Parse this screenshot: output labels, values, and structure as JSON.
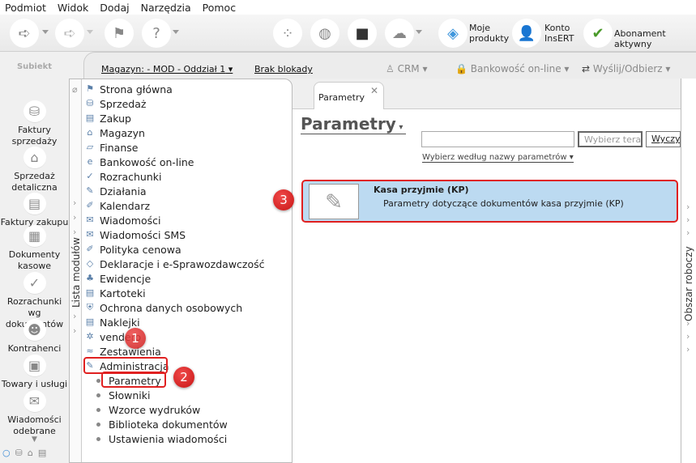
{
  "menu": [
    "Podmiot",
    "Widok",
    "Dodaj",
    "Narzędzia",
    "Pomoc"
  ],
  "toolbar": {
    "moje_produkty": "Moje\nprodukty",
    "moje1": "Moje",
    "moje2": "produkty",
    "konto1": "Konto",
    "konto2": "InsERT",
    "insert_logo": "InsERT",
    "abonament": "Abonament aktywny"
  },
  "logo": {
    "text": "Subiekt"
  },
  "topbar": {
    "magazyn": "Magazyn: - MOD - Oddział 1",
    "blokada": "Brak blokady",
    "crm": "CRM",
    "bank": "Bankowość on-line",
    "wyslij": "Wyślij/Odbierz"
  },
  "leftnav": [
    {
      "l1": "Faktury",
      "l2": "sprzedaży"
    },
    {
      "l1": "Sprzedaż",
      "l2": "detaliczna"
    },
    {
      "l1": "Faktury zakupu",
      "l2": ""
    },
    {
      "l1": "Dokumenty",
      "l2": "kasowe"
    },
    {
      "l1": "Rozrachunki wg",
      "l2": "dokumentów"
    },
    {
      "l1": "Kontrahenci",
      "l2": ""
    },
    {
      "l1": "Towary i usługi",
      "l2": ""
    },
    {
      "l1": "Wiadomości",
      "l2": "odebrane"
    }
  ],
  "modules": {
    "strip_label": "Lista modułów",
    "items": [
      "Strona główna",
      "Sprzedaż",
      "Zakup",
      "Magazyn",
      "Finanse",
      "Bankowość on-line",
      "Rozrachunki",
      "Działania",
      "Kalendarz",
      "Wiadomości",
      "Wiadomości SMS",
      "Polityka cenowa",
      "Deklaracje i e-Sprawozdawczość",
      "Ewidencje",
      "Kartoteki",
      "Ochrona danych osobowych",
      "Naklejki",
      "vendero",
      "Zestawienia",
      "Administracja"
    ],
    "subitems": [
      "Parametry",
      "Słowniki",
      "Wzorce wydruków",
      "Biblioteka dokumentów",
      "Ustawienia wiadomości"
    ]
  },
  "tab": {
    "label": "Parametry"
  },
  "main": {
    "title": "Parametry",
    "search_value": "",
    "select_btn": "Wybierz teraz",
    "clear_btn": "Wyczyść",
    "filter": "Wybierz według nazwy parametrów",
    "row": {
      "title": "Kasa przyjmie (KP)",
      "desc": "Parametry dotyczące dokumentów kasa przyjmie (KP)"
    }
  },
  "right_strip": {
    "label": "Obszar roboczy"
  },
  "annotations": [
    "1",
    "2",
    "3"
  ],
  "colors": {
    "highlight": "#e02020",
    "selected_row": "#bcdaf1"
  }
}
